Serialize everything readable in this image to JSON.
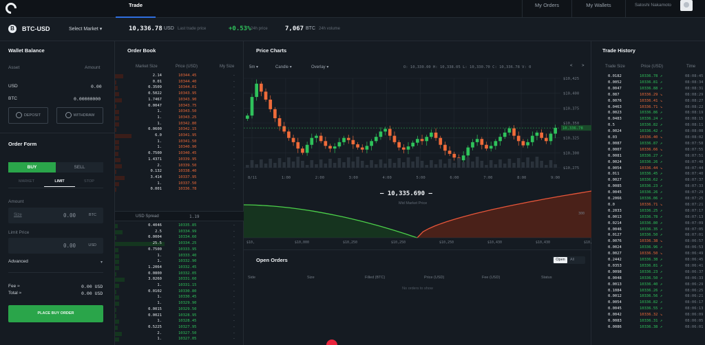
{
  "nav": {
    "trade": "Trade",
    "my_orders": "My Orders",
    "my_wallets": "My Wallets",
    "user": "Satoshi Nakamoto"
  },
  "ticker": {
    "pair": "BTC-USD",
    "select_market": "Select Market",
    "last_price": "10,336.78",
    "last_price_currency": "USD",
    "last_price_label": "Last trade price",
    "change": "+0.53%",
    "change_label": "24h price",
    "volume": "7,067",
    "volume_currency": "BTC",
    "volume_label": "24h volume"
  },
  "wallet": {
    "title": "Wallet Balance",
    "col_asset": "Asset",
    "col_amount": "Amount",
    "usd_label": "USD",
    "usd_value": "0.00",
    "btc_label": "BTC",
    "btc_value": "0.00000000",
    "deposit": "DEPOSIT",
    "withdraw": "WITHDRAW"
  },
  "order_form": {
    "title": "Order Form",
    "buy": "BUY",
    "sell": "SELL",
    "market": "MARKET",
    "limit": "LIMIT",
    "stop": "STOP",
    "amount_label": "Amount",
    "size_placeholder": "Size",
    "amount_value": "0.00",
    "amount_currency": "BTC",
    "limit_label": "Limit Price",
    "limit_value": "0.00",
    "limit_currency": "USD",
    "advanced": "Advanced",
    "fee_label": "Fee ≈",
    "fee_value": "0.00 USD",
    "total_label": "Total ≈",
    "total_value": "0.00 USD",
    "place_order": "PLACE BUY ORDER"
  },
  "order_book": {
    "title": "Order Book",
    "col_size": "Market Size",
    "col_price": "Price (USD)",
    "col_my": "My Size",
    "asks": [
      {
        "size": "2.14",
        "price": "10344.45",
        "depth": 0.15
      },
      {
        "size": "0.01",
        "price": "10344.40",
        "depth": 0.02
      },
      {
        "size": "0.3509",
        "price": "10344.01",
        "depth": 0.05
      },
      {
        "size": "0.5022",
        "price": "10343.95",
        "depth": 0.08
      },
      {
        "size": "1.7467",
        "price": "10343.90",
        "depth": 0.12
      },
      {
        "size": "0.0047",
        "price": "10343.75",
        "depth": 0.02
      },
      {
        "size": "1.",
        "price": "10343.50",
        "depth": 0.07
      },
      {
        "size": "1.",
        "price": "10343.25",
        "depth": 0.07
      },
      {
        "size": "1.",
        "price": "10342.80",
        "depth": 0.07
      },
      {
        "size": "0.0600",
        "price": "10342.15",
        "depth": 0.03
      },
      {
        "size": "6.0",
        "price": "10341.95",
        "depth": 0.3
      },
      {
        "size": "1.",
        "price": "10341.50",
        "depth": 0.07
      },
      {
        "size": "1.",
        "price": "10340.90",
        "depth": 0.07
      },
      {
        "size": "0.7500",
        "price": "10340.45",
        "depth": 0.06
      },
      {
        "size": "1.4371",
        "price": "10339.95",
        "depth": 0.1
      },
      {
        "size": "2.",
        "price": "10339.50",
        "depth": 0.12
      },
      {
        "size": "0.132",
        "price": "10338.40",
        "depth": 0.03
      },
      {
        "size": "3.414",
        "price": "10337.95",
        "depth": 0.18
      },
      {
        "size": "1.",
        "price": "10337.50",
        "depth": 0.07
      },
      {
        "size": "0.001",
        "price": "10336.78",
        "depth": 0.02
      }
    ],
    "spread_label": "USD Spread",
    "spread_value": "1.19",
    "bids": [
      {
        "size": "0.4046",
        "price": "10335.85",
        "depth": 0.05
      },
      {
        "size": "2.5",
        "price": "10334.99",
        "depth": 0.14
      },
      {
        "size": "0.0004",
        "price": "10334.60",
        "depth": 0.02
      },
      {
        "size": "25.5",
        "price": "10334.25",
        "depth": 0.9
      },
      {
        "size": "0.7500",
        "price": "10333.95",
        "depth": 0.06
      },
      {
        "size": "1.",
        "price": "10333.40",
        "depth": 0.07
      },
      {
        "size": "1.",
        "price": "10332.90",
        "depth": 0.07
      },
      {
        "size": "1.2064",
        "price": "10332.45",
        "depth": 0.08
      },
      {
        "size": "0.0800",
        "price": "10332.05",
        "depth": 0.03
      },
      {
        "size": "3.0260",
        "price": "10331.60",
        "depth": 0.17
      },
      {
        "size": "1.",
        "price": "10331.15",
        "depth": 0.07
      },
      {
        "size": "0.0102",
        "price": "10330.80",
        "depth": 0.02
      },
      {
        "size": "1.",
        "price": "10330.45",
        "depth": 0.07
      },
      {
        "size": "1.",
        "price": "10329.90",
        "depth": 0.07
      },
      {
        "size": "0.0015",
        "price": "10329.50",
        "depth": 0.02
      },
      {
        "size": "0.0021",
        "price": "10328.95",
        "depth": 0.02
      },
      {
        "size": "1.",
        "price": "10328.45",
        "depth": 0.07
      },
      {
        "size": "0.5225",
        "price": "10327.95",
        "depth": 0.05
      },
      {
        "size": "2.",
        "price": "10327.50",
        "depth": 0.12
      },
      {
        "size": "1.",
        "price": "10327.05",
        "depth": 0.07
      }
    ]
  },
  "price_charts": {
    "title": "Price Charts",
    "interval": "5m",
    "chart_type": "Candle",
    "overlay": "Overlay",
    "ohlc": "O: 10,330.00  H: 10,338.05  L: 10,330.70  C: 10,336.78  V: 0",
    "last_price_tag": "10,336.78",
    "y_ticks": [
      "$10,425",
      "$10,400",
      "$10,375",
      "$10,350",
      "$10,325",
      "$10,300",
      "$10,275"
    ],
    "x_ticks": [
      "8/11",
      "1:00",
      "2:00",
      "3:00",
      "4:00",
      "5:00",
      "6:00",
      "7:00",
      "8:00",
      "9:00"
    ],
    "mid_price": "10,335.690",
    "mid_price_label": "Mid Market Price",
    "depth_x_ticks": [
      "$10,",
      "$10,000",
      "$10,250",
      "$10,250",
      "$10,250",
      "$10,430",
      "$10,430",
      "$10,650"
    ],
    "depth_right_label": "300"
  },
  "open_orders": {
    "title": "Open Orders",
    "toggle_open": "Open",
    "toggle_all": "All",
    "columns": [
      "Side",
      "Size",
      "Filled (BTC)",
      "Price (USD)",
      "Fee (USD)",
      "Status"
    ],
    "empty": "No orders to show"
  },
  "trade_history": {
    "title": "Trade History",
    "col_size": "Trade Size",
    "col_price": "Price (USD)",
    "col_time": "Time",
    "rows": [
      {
        "size": "0.0182",
        "price": "10336.78",
        "dir": "up",
        "time": "08:08:45"
      },
      {
        "size": "0.0052",
        "price": "10336.81",
        "dir": "up",
        "time": "08:08:34"
      },
      {
        "size": "0.0047",
        "price": "10336.88",
        "dir": "up",
        "time": "08:08:31"
      },
      {
        "size": "0.087",
        "price": "10336.29",
        "dir": "down",
        "time": "08:08:29"
      },
      {
        "size": "0.0076",
        "price": "10336.41",
        "dir": "down",
        "time": "08:08:27"
      },
      {
        "size": "0.0463",
        "price": "10336.71",
        "dir": "down",
        "time": "08:08:22"
      },
      {
        "size": "0.0023",
        "price": "10336.86",
        "dir": "up",
        "time": "08:08:19"
      },
      {
        "size": "0.0483",
        "price": "10336.24",
        "dir": "up",
        "time": "08:08:15"
      },
      {
        "size": "0.5",
        "price": "10336.82",
        "dir": "up",
        "time": "08:08:11"
      },
      {
        "size": "0.0024",
        "price": "10336.42",
        "dir": "up",
        "time": "08:08:08"
      },
      {
        "size": "0.03",
        "price": "10336.40",
        "dir": "down",
        "time": "08:08:02"
      },
      {
        "size": "0.0087",
        "price": "10336.87",
        "dir": "up",
        "time": "08:07:58"
      },
      {
        "size": "0.0007",
        "price": "10336.66",
        "dir": "down",
        "time": "08:07:55"
      },
      {
        "size": "0.0081",
        "price": "10336.27",
        "dir": "up",
        "time": "08:07:51"
      },
      {
        "size": "0.0024",
        "price": "10336.26",
        "dir": "up",
        "time": "08:07:48"
      },
      {
        "size": "0.0054",
        "price": "10336.44",
        "dir": "down",
        "time": "08:07:44"
      },
      {
        "size": "0.011",
        "price": "10336.45",
        "dir": "up",
        "time": "08:07:40"
      },
      {
        "size": "0.0027",
        "price": "10336.62",
        "dir": "up",
        "time": "08:07:37"
      },
      {
        "size": "0.0085",
        "price": "10336.23",
        "dir": "up",
        "time": "08:07:33"
      },
      {
        "size": "0.0045",
        "price": "10336.26",
        "dir": "up",
        "time": "08:07:29"
      },
      {
        "size": "0.2066",
        "price": "10336.06",
        "dir": "up",
        "time": "08:07:25"
      },
      {
        "size": "0.0",
        "price": "10336.71",
        "dir": "down",
        "time": "08:07:21"
      },
      {
        "size": "0.2033",
        "price": "10336.25",
        "dir": "up",
        "time": "08:07:17"
      },
      {
        "size": "0.0013",
        "price": "10336.78",
        "dir": "up",
        "time": "08:07:13"
      },
      {
        "size": "0.0214",
        "price": "10336.80",
        "dir": "up",
        "time": "08:07:09"
      },
      {
        "size": "0.0046",
        "price": "10336.35",
        "dir": "up",
        "time": "08:07:05"
      },
      {
        "size": "0.0127",
        "price": "10336.50",
        "dir": "up",
        "time": "08:07:01"
      },
      {
        "size": "0.0076",
        "price": "10336.38",
        "dir": "down",
        "time": "08:06:57"
      },
      {
        "size": "0.0024",
        "price": "10336.96",
        "dir": "up",
        "time": "08:06:53"
      },
      {
        "size": "0.0027",
        "price": "10336.50",
        "dir": "down",
        "time": "08:06:49"
      },
      {
        "size": "0.2442",
        "price": "10336.38",
        "dir": "up",
        "time": "08:06:45"
      },
      {
        "size": "0.0353",
        "price": "10336.81",
        "dir": "up",
        "time": "08:06:41"
      },
      {
        "size": "0.0098",
        "price": "10336.23",
        "dir": "up",
        "time": "08:06:37"
      },
      {
        "size": "0.0048",
        "price": "10336.50",
        "dir": "up",
        "time": "08:06:33"
      },
      {
        "size": "0.0013",
        "price": "10336.40",
        "dir": "up",
        "time": "08:06:29"
      },
      {
        "size": "0.1084",
        "price": "10336.26",
        "dir": "up",
        "time": "08:06:25"
      },
      {
        "size": "0.0012",
        "price": "10336.56",
        "dir": "up",
        "time": "08:06:21"
      },
      {
        "size": "0.0054",
        "price": "10336.82",
        "dir": "up",
        "time": "08:06:17"
      },
      {
        "size": "0.0045",
        "price": "10336.55",
        "dir": "up",
        "time": "08:06:13"
      },
      {
        "size": "0.0042",
        "price": "10336.32",
        "dir": "down",
        "time": "08:06:09"
      },
      {
        "size": "0.0083",
        "price": "10336.31",
        "dir": "up",
        "time": "08:06:05"
      },
      {
        "size": "0.0086",
        "price": "10336.38",
        "dir": "up",
        "time": "08:06:01"
      }
    ]
  },
  "colors": {
    "up": "#2fc25b",
    "down": "#ef6b3a",
    "accent": "#2f6fe0",
    "buy": "#2aa54a"
  },
  "icons": [
    "coinbase-logo-icon",
    "bitcoin-icon",
    "chevron-down-icon",
    "deposit-icon",
    "withdraw-icon",
    "arrow-up-icon",
    "arrow-down-icon"
  ]
}
